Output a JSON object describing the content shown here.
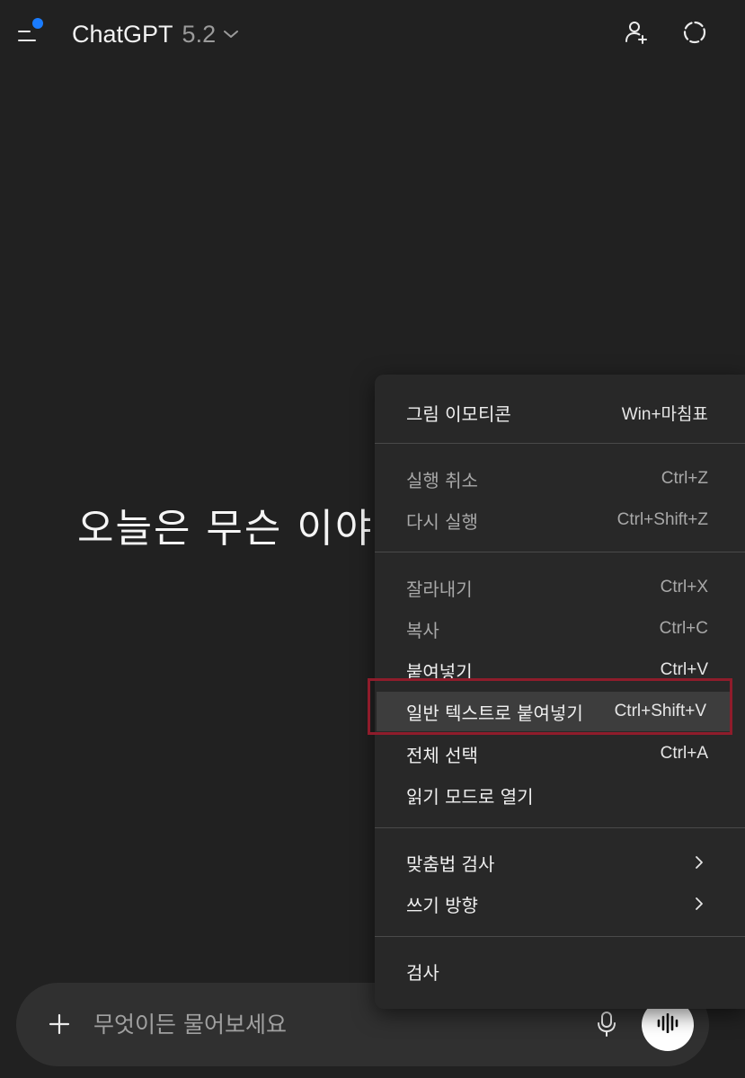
{
  "header": {
    "model_name": "ChatGPT",
    "model_version": "5.2"
  },
  "main": {
    "greeting": "오늘은 무슨 이야기를 하고 싶으신가요?"
  },
  "composer": {
    "placeholder": "무엇이든 물어보세요"
  },
  "context_menu": {
    "items": [
      {
        "label": "그림 이모티콘",
        "shortcut": "Win+마침표",
        "enabled": true
      },
      {
        "label": "실행 취소",
        "shortcut": "Ctrl+Z",
        "enabled": false
      },
      {
        "label": "다시 실행",
        "shortcut": "Ctrl+Shift+Z",
        "enabled": false
      },
      {
        "label": "잘라내기",
        "shortcut": "Ctrl+X",
        "enabled": false
      },
      {
        "label": "복사",
        "shortcut": "Ctrl+C",
        "enabled": false
      },
      {
        "label": "붙여넣기",
        "shortcut": "Ctrl+V",
        "enabled": true
      },
      {
        "label": "일반 텍스트로 붙여넣기",
        "shortcut": "Ctrl+Shift+V",
        "enabled": true,
        "highlighted": true
      },
      {
        "label": "전체 선택",
        "shortcut": "Ctrl+A",
        "enabled": true
      },
      {
        "label": "읽기 모드로 열기",
        "shortcut": "",
        "enabled": true
      },
      {
        "label": "맞춤법 검사",
        "shortcut": "",
        "enabled": true,
        "submenu": true
      },
      {
        "label": "쓰기 방향",
        "shortcut": "",
        "enabled": true,
        "submenu": true
      },
      {
        "label": "검사",
        "shortcut": "",
        "enabled": true
      }
    ]
  },
  "colors": {
    "background": "#212121",
    "composer_bg": "#303030",
    "menu_bg": "#282828",
    "menu_highlight": "#3d3d3d",
    "accent_dot": "#1a7cff",
    "annotation_border": "#8f1c2b"
  },
  "icons": {
    "menu": "sidebar-toggle-icon",
    "model_dropdown": "chevron-down-icon",
    "add_person": "add-person-icon",
    "temporary_chat": "temporary-chat-icon",
    "plus": "plus-icon",
    "mic": "microphone-icon",
    "voice": "voice-waveform-icon",
    "submenu": "chevron-right-icon"
  }
}
